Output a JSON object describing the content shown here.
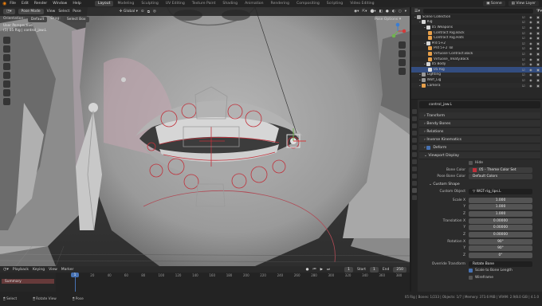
{
  "menus": [
    "File",
    "Edit",
    "Render",
    "Window",
    "Help"
  ],
  "workspaces": [
    "Layout",
    "Modeling",
    "Sculpting",
    "UV Editing",
    "Texture Paint",
    "Shading",
    "Animation",
    "Rendering",
    "Compositing",
    "Scripting",
    "Video Editing"
  ],
  "active_workspace": "Layout",
  "scene": "Scene",
  "view_layer": "View Layer",
  "viewport": {
    "mode": "Pose Mode",
    "menu": [
      "View",
      "Select",
      "Pose"
    ],
    "orientation_label": "Orientation:",
    "orientation": "Default",
    "drag_label": "Drag:",
    "drag": "Select Box",
    "transform": "Global",
    "pose_options": "Pose Options",
    "info_line1": "User Perspective",
    "info_line2": "(1) 05 Rig | control_jaw.L"
  },
  "outliner": {
    "rows": [
      {
        "label": "Scene Collection",
        "indent": 0,
        "color": "#aaaaaa",
        "sel": false
      },
      {
        "label": "Rig",
        "indent": 1,
        "color": "#d8d8d8",
        "sel": false
      },
      {
        "label": "05 Weapons",
        "indent": 2,
        "color": "#d8d8d8",
        "sel": false
      },
      {
        "label": "Contract Rig.Back",
        "indent": 3,
        "color": "#e8a04a",
        "sel": false
      },
      {
        "label": "Contract Rig.Hats",
        "indent": 3,
        "color": "#e8a04a",
        "sel": false
      },
      {
        "label": "Prd 5+2",
        "indent": 2,
        "color": "#d8d8d8",
        "sel": false
      },
      {
        "label": "Prd 5+2 Tol",
        "indent": 3,
        "color": "#e8a04a",
        "sel": false
      },
      {
        "label": "Virtuose Contract.Back",
        "indent": 3,
        "color": "#e8a04a",
        "sel": false
      },
      {
        "label": "Virtuose_Treaty.Back",
        "indent": 3,
        "color": "#e8a04a",
        "sel": false
      },
      {
        "label": "05 Body",
        "indent": 2,
        "color": "#d8d8d8",
        "sel": false
      },
      {
        "label": "05 Rig",
        "indent": 3,
        "color": "#dddddd",
        "sel": true
      },
      {
        "label": "Lighting",
        "indent": 1,
        "color": "#999999",
        "sel": false
      },
      {
        "label": "Wolf_Lig",
        "indent": 1,
        "color": "#999999",
        "sel": false
      },
      {
        "label": "Camera",
        "indent": 1,
        "color": "#e8a04a",
        "sel": false
      }
    ]
  },
  "properties": {
    "bone_name": "control_jaw.L",
    "sections": [
      "Transform",
      "Bendy Bones",
      "Relations",
      "Inverse Kinematics",
      "Deform"
    ],
    "viewport_display": "Viewport Display",
    "hide_label": "Hide",
    "bone_color_label": "Bone Color",
    "bone_color": "05 - Theme Color Set",
    "pose_bone_color_label": "Pose Bone Color",
    "pose_bone_color": "Default Colors",
    "custom_shape": "Custom Shape",
    "custom_object_label": "Custom Object",
    "custom_object": "WGT-rig_lips.L",
    "scale_x_label": "Scale X",
    "scale_x": "1.000",
    "scale_y_label": "Y",
    "scale_y": "1.000",
    "scale_z_label": "Z",
    "scale_z": "1.000",
    "trans_x_label": "Translation X",
    "trans_x": "0.00000",
    "trans_y_label": "Y",
    "trans_y": "0.00000",
    "trans_z_label": "Z",
    "trans_z": "0.00000",
    "rot_x_label": "Rotation X",
    "rot_x": "90°",
    "rot_y_label": "Y",
    "rot_y": "90°",
    "rot_z_label": "Z",
    "rot_z": "0°",
    "override_label": "Override Transform",
    "override": "Rotate Bone",
    "scale_bone_len": "Scale to Bone Length",
    "wireframe": "Wireframe"
  },
  "timeline": {
    "menu": [
      "Playback",
      "Keying",
      "View",
      "Marker"
    ],
    "summary": "Summary",
    "start_label": "Start",
    "start": "1",
    "end_label": "End",
    "end": "250",
    "frame": "1",
    "ticks": [
      "0",
      "20",
      "40",
      "60",
      "80",
      "100",
      "120",
      "140",
      "160",
      "180",
      "200",
      "220",
      "240",
      "260",
      "280",
      "300",
      "320",
      "340"
    ],
    "ticks_right": [
      "360",
      "380"
    ]
  },
  "statusbar": {
    "select": "Select",
    "rotate_view": "Rotate View",
    "pose": "Pose",
    "stats": "05 Rig | Bones: 1/233 | Objects: 1/7 | Memory: 373.6 MiB | VRAM: 2.9/8.0 GiB | 4.1.0"
  },
  "colors": {
    "accent": "#4772b3",
    "selection": "#334d80",
    "summary": "#663a3a",
    "bone_red": "#c0303a"
  }
}
